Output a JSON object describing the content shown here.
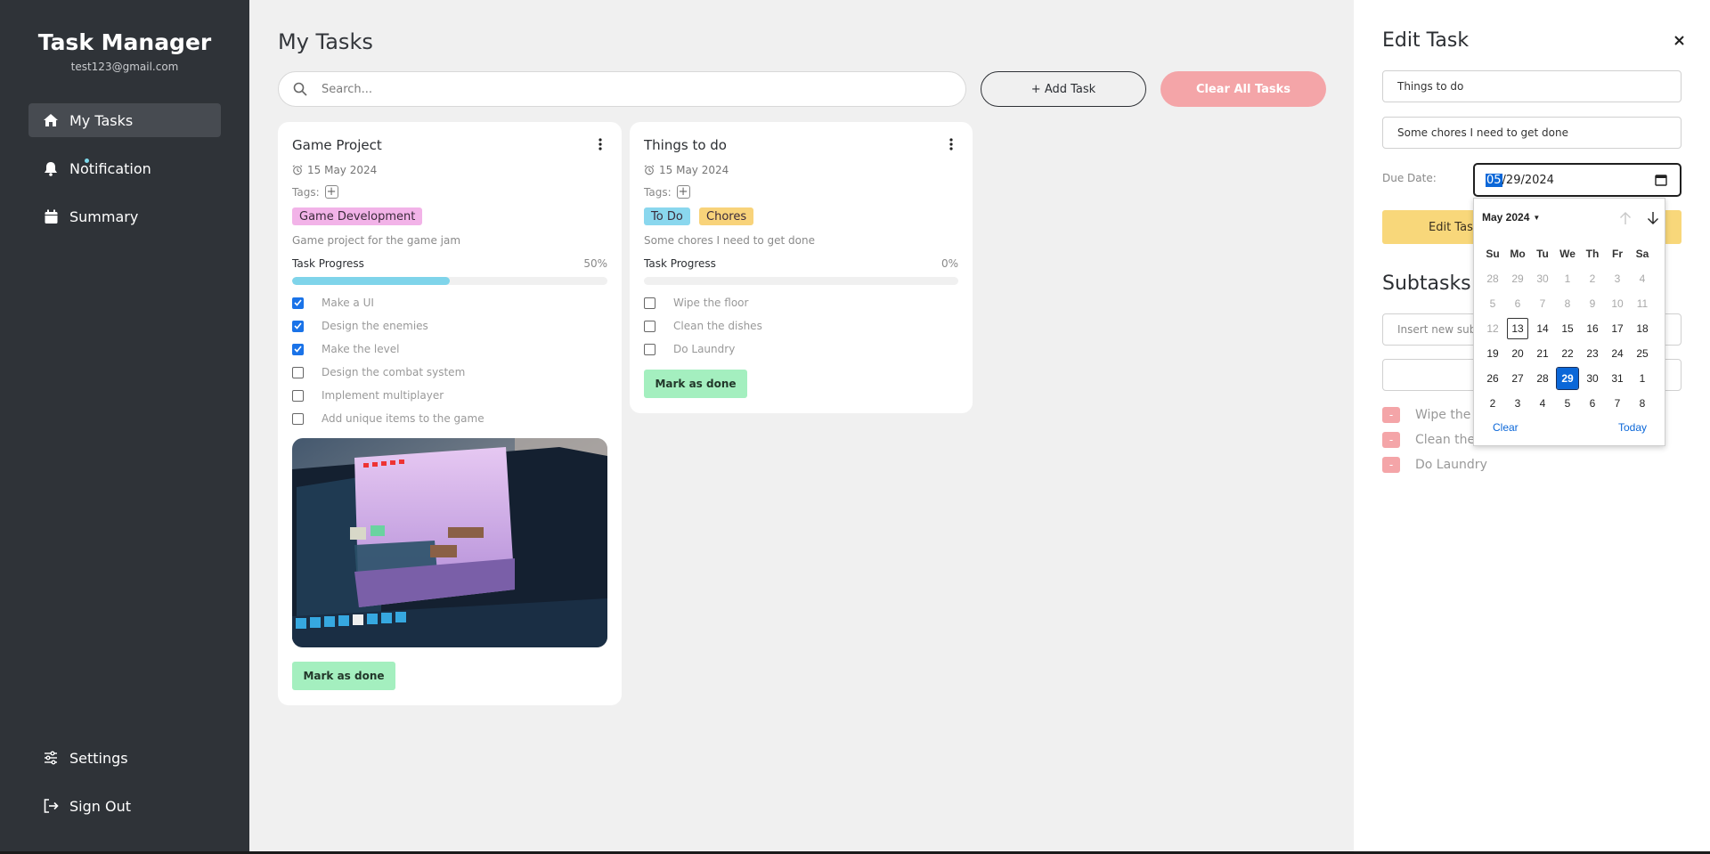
{
  "app": {
    "title": "Task Manager",
    "email": "test123@gmail.com"
  },
  "sidebar": {
    "items": [
      {
        "label": "My Tasks",
        "icon": "home-icon",
        "active": true
      },
      {
        "label": "Notification",
        "icon": "bell-icon"
      },
      {
        "label": "Summary",
        "icon": "calendar-icon"
      }
    ],
    "bottom": [
      {
        "label": "Settings",
        "icon": "sliders-icon"
      },
      {
        "label": "Sign Out",
        "icon": "sign-out-icon"
      }
    ]
  },
  "main": {
    "title": "My Tasks",
    "search_placeholder": "Search...",
    "add_label": "+ Add Task",
    "clear_label": "Clear All Tasks"
  },
  "tasks": [
    {
      "title": "Game Project",
      "date": "15 May 2024",
      "tags_label": "Tags:",
      "tags": [
        {
          "label": "Game Development",
          "color": "#f2b3e8"
        }
      ],
      "description": "Game project for the game jam",
      "progress_label": "Task Progress",
      "progress_pct": "50%",
      "progress": 0.5,
      "subtasks": [
        {
          "label": "Make a UI",
          "done": true
        },
        {
          "label": "Design the enemies",
          "done": true
        },
        {
          "label": "Make the level",
          "done": true
        },
        {
          "label": "Design the combat system",
          "done": false
        },
        {
          "label": "Implement multiplayer",
          "done": false
        },
        {
          "label": "Add unique items to the game",
          "done": false
        }
      ],
      "done_label": "Mark as done"
    },
    {
      "title": "Things to do",
      "date": "15 May 2024",
      "tags_label": "Tags:",
      "tags": [
        {
          "label": "To Do",
          "color": "#8ad7ee"
        },
        {
          "label": "Chores",
          "color": "#f8d37a"
        }
      ],
      "description": "Some chores I need to get done",
      "progress_label": "Task Progress",
      "progress_pct": "0%",
      "progress": 0,
      "subtasks": [
        {
          "label": "Wipe the floor",
          "done": false
        },
        {
          "label": "Clean the dishes",
          "done": false
        },
        {
          "label": "Do Laundry",
          "done": false
        }
      ],
      "done_label": "Mark as done"
    }
  ],
  "edit": {
    "title": "Edit Task",
    "name_value": "Things to do",
    "desc_value": "Some chores I need to get done",
    "due_label": "Due Date:",
    "due_month": "05",
    "due_rest": "/29/2024",
    "edit_button": "Edit Tas",
    "subtasks_title": "Subtasks",
    "subtask_placeholder": "Insert new sub",
    "subtasks": [
      {
        "label": "Wipe the"
      },
      {
        "label": "Clean the"
      },
      {
        "label": "Do Laundry"
      }
    ],
    "remove_label": "-"
  },
  "datepicker": {
    "month_label": "May 2024",
    "weekdays": [
      "Su",
      "Mo",
      "Tu",
      "We",
      "Th",
      "Fr",
      "Sa"
    ],
    "days": [
      [
        "28",
        "29",
        "30",
        "1",
        "2",
        "3",
        "4"
      ],
      [
        "5",
        "6",
        "7",
        "8",
        "9",
        "10",
        "11"
      ],
      [
        "12",
        "13",
        "14",
        "15",
        "16",
        "17",
        "18"
      ],
      [
        "19",
        "20",
        "21",
        "22",
        "23",
        "24",
        "25"
      ],
      [
        "26",
        "27",
        "28",
        "29",
        "30",
        "31",
        "1"
      ],
      [
        "2",
        "3",
        "4",
        "5",
        "6",
        "7",
        "8"
      ]
    ],
    "clear_label": "Clear",
    "today_label": "Today",
    "selected": "29",
    "today": "13"
  },
  "colors": {
    "sidebar_bg": "#2f3338",
    "accent_blue": "#0b67d8",
    "progress_fill": "#7fd4ea",
    "done_button": "#a4efbf",
    "clear_button": "#f4a5a8",
    "edit_button": "#f8d77a"
  }
}
